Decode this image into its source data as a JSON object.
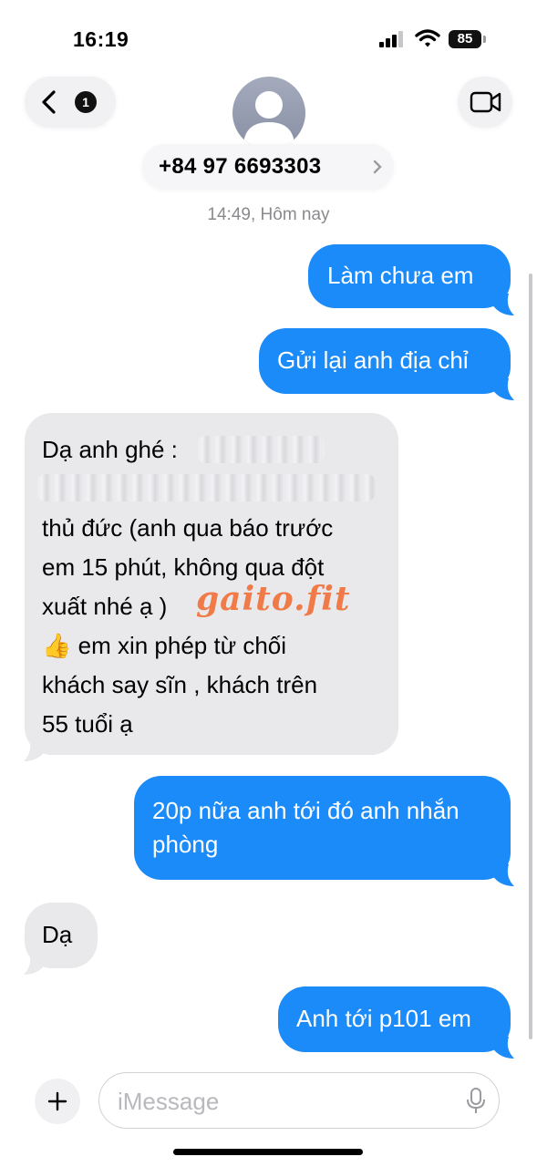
{
  "status_bar": {
    "time": "16:19",
    "battery": "85"
  },
  "nav": {
    "back_count": "1",
    "contact_number": "+84 97 6693303"
  },
  "thread": {
    "timestamp": "14:49, Hôm nay",
    "messages": [
      {
        "from": "me",
        "text": "Làm chưa em"
      },
      {
        "from": "me",
        "text": "Gửi lại anh địa chỉ"
      },
      {
        "from": "them",
        "lines": [
          "Dạ anh ghé :",
          "thủ đức (anh qua  báo trước",
          "em 15 phút,  không qua đột",
          "xuất  nhé ạ )",
          "em xin phép từ chối",
          "khách say sĩn , khách trên",
          "55 tuổi ạ"
        ],
        "emoji": "👍"
      },
      {
        "from": "me",
        "lines": [
          "20p nữa anh tới đó anh nhắn",
          "phòng"
        ]
      },
      {
        "from": "them",
        "text": "Dạ"
      },
      {
        "from": "me",
        "text": "Anh tới p101 em"
      }
    ]
  },
  "watermark": "gaito.fit",
  "composer": {
    "placeholder": "iMessage"
  },
  "colors": {
    "sent_bubble": "#1a8bf8",
    "received_bubble": "#e9e9eb",
    "watermark": "#f07b48"
  }
}
